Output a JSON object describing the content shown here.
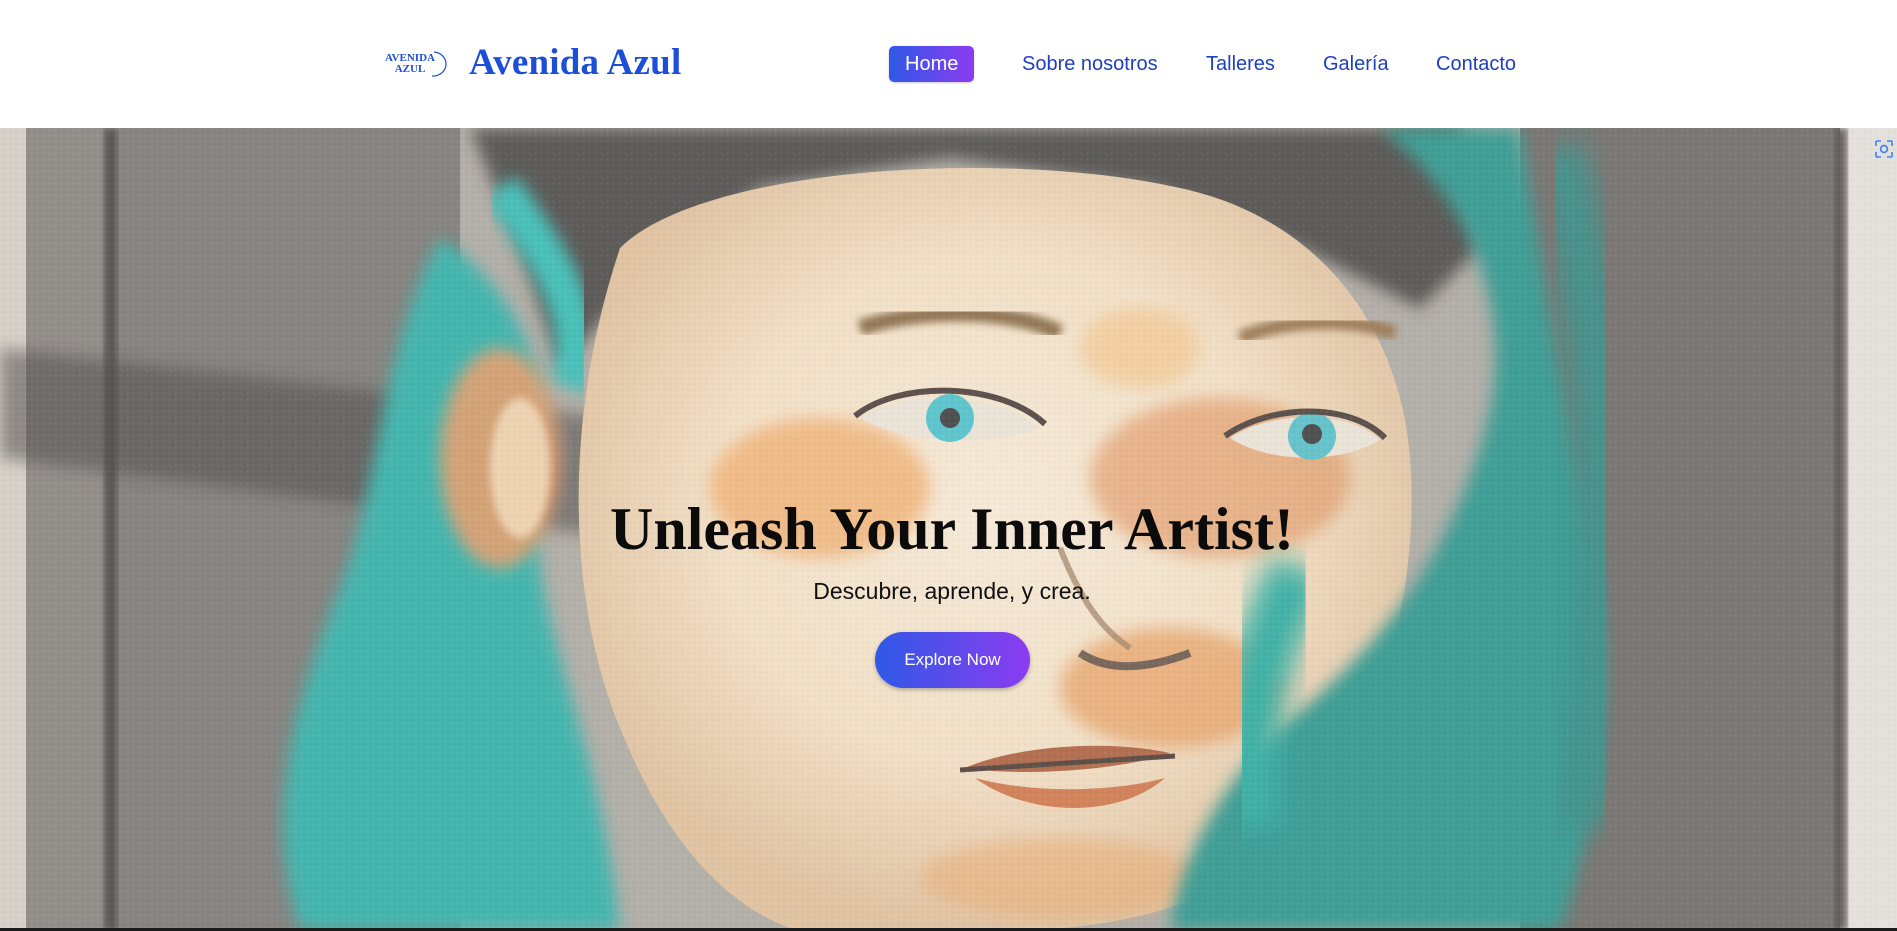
{
  "brand": {
    "logo_text_line1": "AVENIDA",
    "logo_text_line2": "AZUL",
    "name": "Avenida Azul"
  },
  "nav": {
    "items": [
      {
        "label": "Home",
        "active": true
      },
      {
        "label": "Sobre nosotros",
        "active": false
      },
      {
        "label": "Talleres",
        "active": false
      },
      {
        "label": "Galería",
        "active": false
      },
      {
        "label": "Contacto",
        "active": false
      }
    ]
  },
  "hero": {
    "title": "Unleash Your Inner Artist!",
    "subtitle": "Descubre, aprende, y crea.",
    "cta_label": "Explore Now",
    "background_image": "watercolor-portrait-teal-hair"
  },
  "icons": {
    "visual_search": "visual-search-icon"
  },
  "colors": {
    "brand_blue": "#1d4ed8",
    "nav_text": "#1e3fbf",
    "gradient_start": "#2f59e6",
    "gradient_end": "#8b3cf0"
  }
}
